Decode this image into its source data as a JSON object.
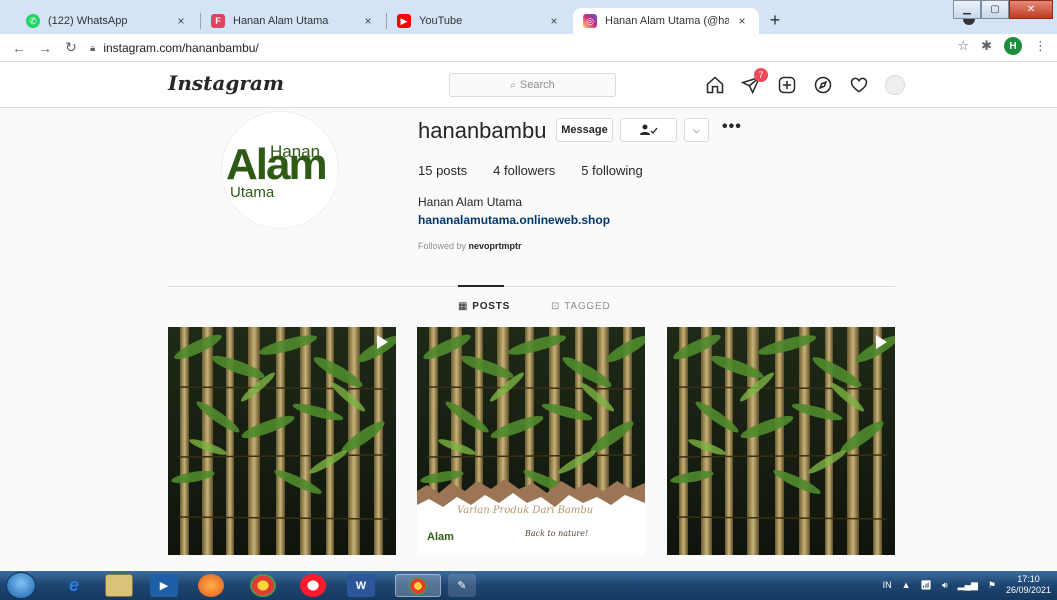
{
  "browser": {
    "tabs": [
      {
        "title": "(122) WhatsApp",
        "close": "×"
      },
      {
        "title": "Hanan Alam Utama",
        "close": "×"
      },
      {
        "title": "YouTube",
        "close": "×"
      },
      {
        "title": "Hanan Alam Utama (@hananbar",
        "close": "×"
      }
    ],
    "new_tab": "+",
    "url": "instagram.com/hananbambu/",
    "profile_initial": "H"
  },
  "ig": {
    "logo": "Instagram",
    "search_placeholder": "Search",
    "activity_badge": "7"
  },
  "profile": {
    "logo_hanan": "Hanan",
    "logo_alam": "Alam",
    "logo_utama": "Utama",
    "username": "hananbambu",
    "message_button": "Message",
    "more": "•••",
    "posts": "15 posts",
    "followers": "4 followers",
    "following": "5 following",
    "full_name": "Hanan Alam Utama",
    "website": "hananalamutama.onlineweb.shop",
    "followed_by_prefix": "Followed by ",
    "followed_by_user": "nevoprtmptr"
  },
  "tabs": {
    "posts": "POSTS",
    "tagged": "TAGGED"
  },
  "grid": {
    "post2_caption": "Varian Produk Dari Bambu",
    "post2_subcaption": "Back to nature!",
    "post2_logo": "Alam"
  },
  "taskbar": {
    "lang": "IN",
    "time": "17:10",
    "date": "26/09/2021"
  }
}
